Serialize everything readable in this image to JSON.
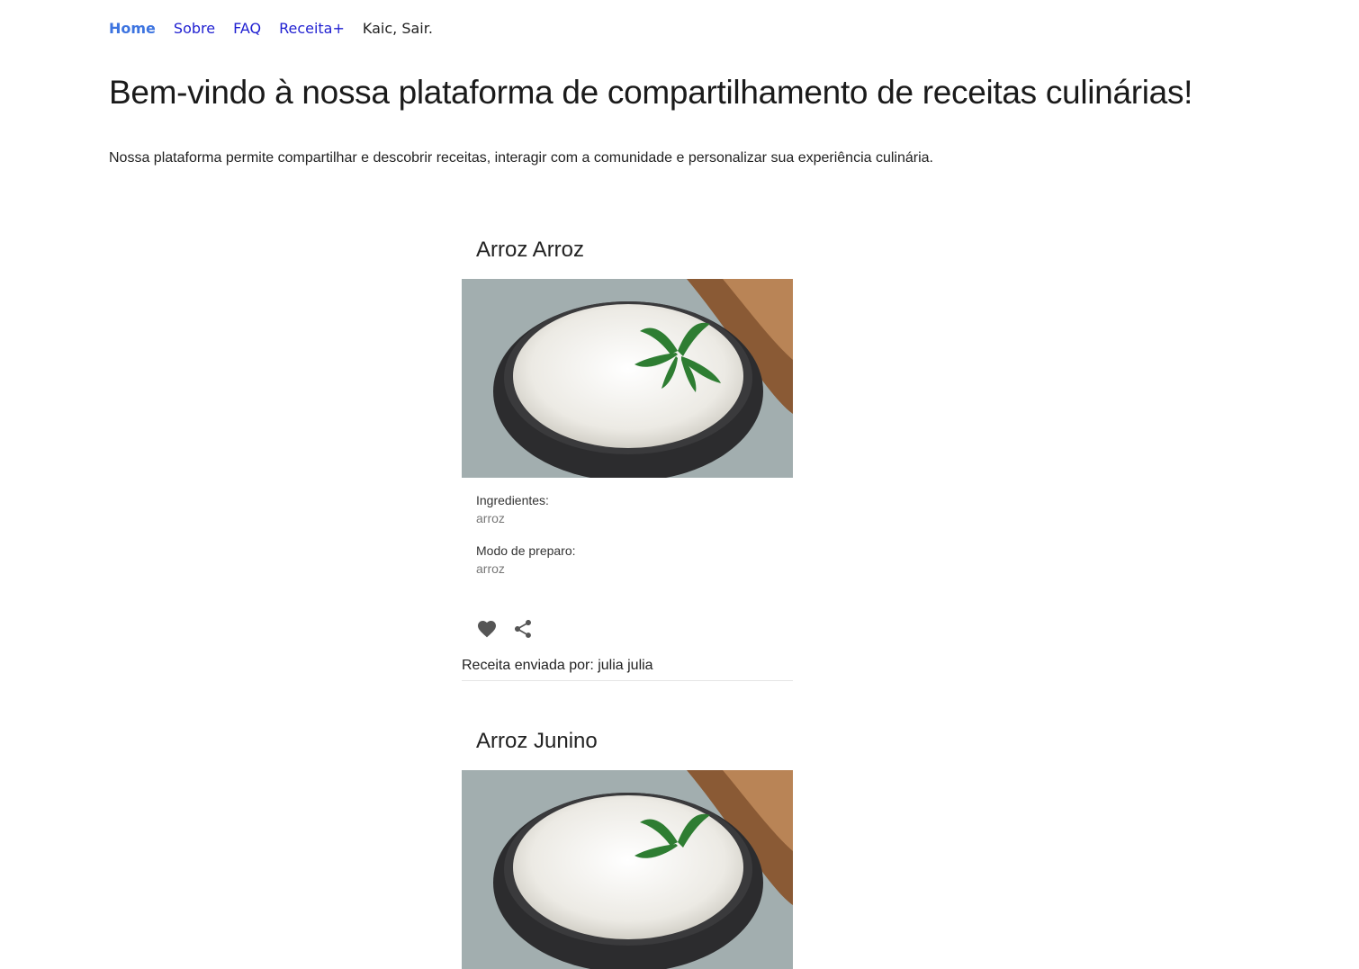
{
  "nav": {
    "home": "Home",
    "about": "Sobre",
    "faq": "FAQ",
    "add_recipe": "Receita+",
    "user": "Kaic, Sair."
  },
  "page": {
    "title": "Bem-vindo à nossa plataforma de compartilhamento de receitas culinárias!",
    "intro": "Nossa plataforma permite compartilhar e descobrir receitas, interagir com a comunidade e personalizar sua experiência culinária."
  },
  "recipes": [
    {
      "title": "Arroz Arroz",
      "image": "rice-bowl-photo",
      "ingredients_label": "Ingredientes:",
      "ingredients": "arroz",
      "method_label": "Modo de preparo:",
      "method": "arroz",
      "author": "Receita enviada por: julia julia"
    },
    {
      "title": "Arroz Junino",
      "image": "rice-bowl-photo"
    }
  ],
  "colors": {
    "nav_link": "#1f1fd1",
    "nav_active": "#3d74e0",
    "icon": "#555555"
  }
}
